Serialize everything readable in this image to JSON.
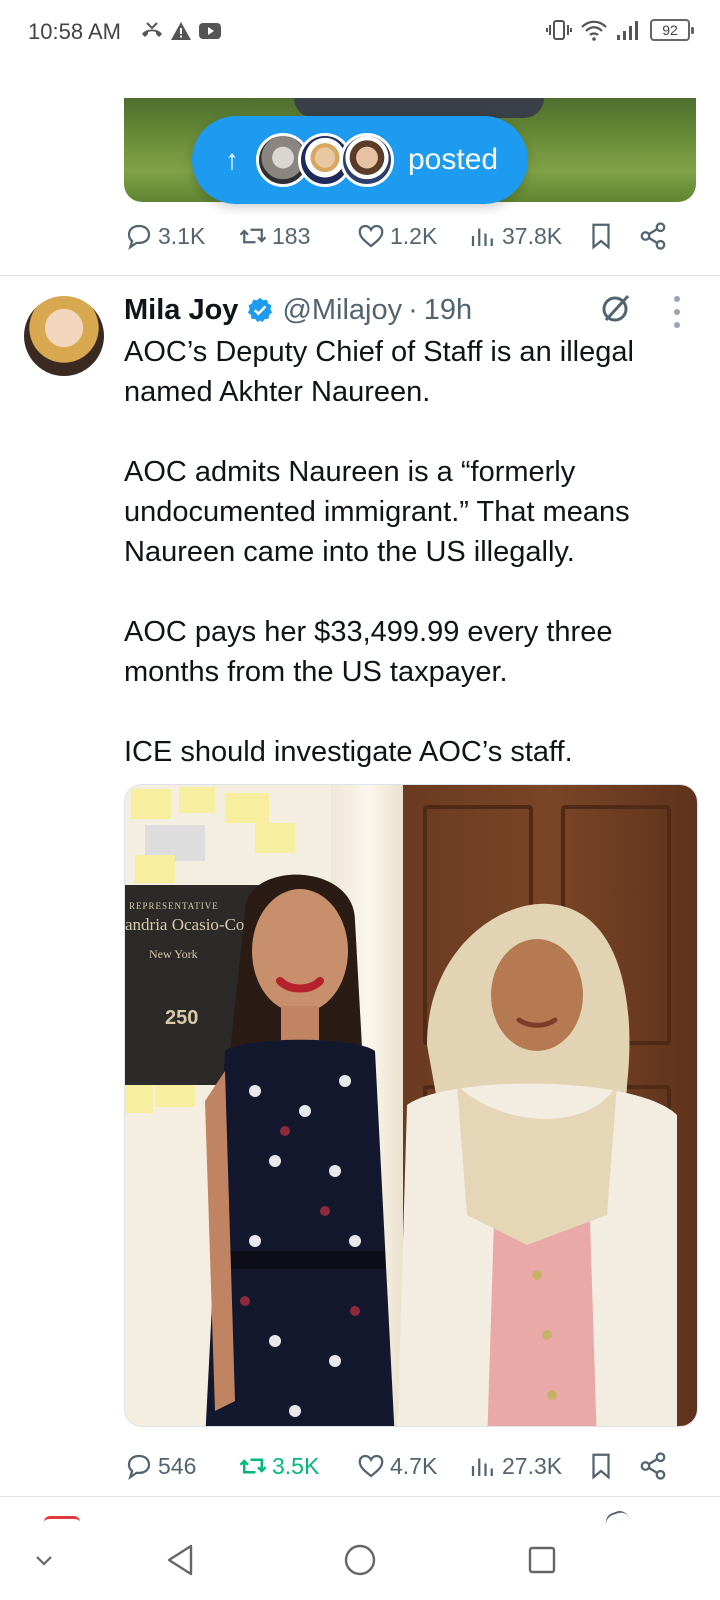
{
  "status_bar": {
    "time": "10:58 AM",
    "battery": "92",
    "icons_left": [
      "missed-call-icon",
      "warning-icon",
      "youtube-icon"
    ],
    "icons_right": [
      "vibrate-icon",
      "wifi-icon",
      "signal-icon",
      "battery-icon"
    ]
  },
  "prev_tweet": {
    "posted_pill_label": "posted",
    "actions": {
      "replies": "3.1K",
      "reposts": "183",
      "likes": "1.2K",
      "views": "37.8K"
    }
  },
  "tweet": {
    "name": "Mila Joy",
    "handle": "@Milajoy",
    "separator": "·",
    "time": "19h",
    "paragraphs": [
      "AOC’s Deputy Chief of Staff is an illegal named Akhter Naureen.",
      "AOC admits Naureen is a “formerly undocumented immigrant.” That means Naureen came into the US illegally.",
      "AOC pays her $33,499.99 every three months from the US taxpayer.",
      "ICE should investigate AOC’s staff."
    ],
    "photo_plaque_text": [
      "REPRESENTATIVE",
      "andria Ocasio-Corte",
      "New York",
      "250"
    ],
    "actions": {
      "replies": "546",
      "reposts": "3.5K",
      "likes": "4.7K",
      "views": "27.3K"
    }
  },
  "colors": {
    "accent": "#1d9bf0",
    "repost_active": "#00ba7c",
    "secondary_text": "#536471"
  }
}
